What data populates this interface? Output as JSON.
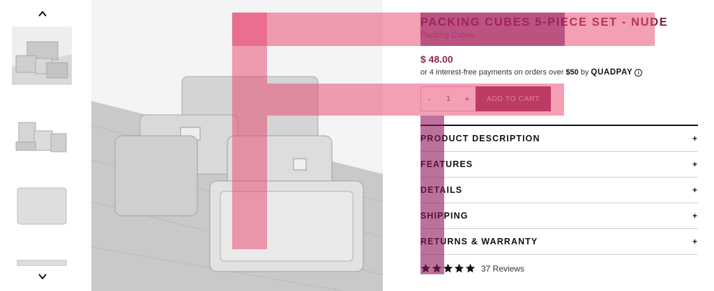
{
  "gallery": {
    "scroll_up_icon": "chevron-up-icon",
    "scroll_down_icon": "chevron-down-icon",
    "thumbnails": [
      "thumbnail-1",
      "thumbnail-2",
      "thumbnail-3",
      "thumbnail-4"
    ]
  },
  "product": {
    "title": "PACKING CUBES 5-PIECE SET - NUDE",
    "subtitle": "Packing Cubes",
    "price": "$ 48.00",
    "installments": {
      "prefix": "or 4 interest-free payments on orders over",
      "threshold": "$50",
      "by": "by",
      "provider": "QUADPAY",
      "info_icon": "info-icon",
      "info_glyph": "i"
    },
    "quantity": {
      "minus": "-",
      "value": "1",
      "plus": "+"
    },
    "add_to_cart": "ADD TO CART"
  },
  "accordion": [
    {
      "label": "PRODUCT DESCRIPTION",
      "toggle": "+"
    },
    {
      "label": "FEATURES",
      "toggle": "+"
    },
    {
      "label": "DETAILS",
      "toggle": "+"
    },
    {
      "label": "SHIPPING",
      "toggle": "+"
    },
    {
      "label": "RETURNS & WARRANTY",
      "toggle": "+"
    }
  ],
  "rating": {
    "stars": 5,
    "reviews": "37 Reviews"
  },
  "colors": {
    "brand": "#8c2f58",
    "overlay": "#e8466f",
    "overlay_dark": "#9c1d6a"
  }
}
